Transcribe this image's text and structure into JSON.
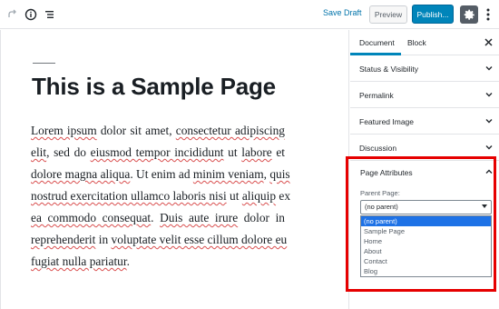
{
  "toolbar": {
    "redo_icon": "redo-icon",
    "info_icon": "info-icon",
    "outline_icon": "block-navigation-icon",
    "save_draft": "Save Draft",
    "preview": "Preview",
    "publish": "Publish...",
    "settings_icon": "gear-icon",
    "more_icon": "more-vertical-icon",
    "accent_color": "#0085ba"
  },
  "editor": {
    "title": "This is a Sample Page",
    "paragraph_lines": [
      [
        {
          "t": "Lorem ipsum",
          "sp": true
        },
        {
          "t": " dolor sit amet, ",
          "sp": false
        },
        {
          "t": "consectetur adipiscing",
          "sp": true
        }
      ],
      [
        {
          "t": "elit",
          "sp": true
        },
        {
          "t": ", sed do ",
          "sp": false
        },
        {
          "t": "eiusmod tempor incididunt",
          "sp": true
        },
        {
          "t": " ut ",
          "sp": false
        },
        {
          "t": "labore",
          "sp": true
        },
        {
          "t": " et",
          "sp": false
        }
      ],
      [
        {
          "t": "dolore magna aliqua",
          "sp": true
        },
        {
          "t": ". Ut enim ad ",
          "sp": false
        },
        {
          "t": "minim veniam",
          "sp": true
        },
        {
          "t": ", ",
          "sp": false
        },
        {
          "t": "quis",
          "sp": true
        }
      ],
      [
        {
          "t": "nostrud exercitation ullamco laboris nisi",
          "sp": true
        },
        {
          "t": " ut ",
          "sp": false
        },
        {
          "t": "aliquip",
          "sp": true
        },
        {
          "t": " ex",
          "sp": false
        }
      ],
      [
        {
          "t": "ea commodo consequat",
          "sp": true
        },
        {
          "t": ". ",
          "sp": false
        },
        {
          "t": "Duis aute irure",
          "sp": true
        },
        {
          "t": " dolor in",
          "sp": false
        }
      ],
      [
        {
          "t": "reprehenderit",
          "sp": true
        },
        {
          "t": " in ",
          "sp": false
        },
        {
          "t": "voluptate velit esse cillum dolore eu",
          "sp": true
        }
      ],
      [
        {
          "t": "fugiat nulla pariatur",
          "sp": true
        },
        {
          "t": ".",
          "sp": false
        }
      ]
    ]
  },
  "sidebar": {
    "tabs": [
      "Document",
      "Block"
    ],
    "close_icon": "close-icon",
    "panels": [
      "Status & Visibility",
      "Permalink",
      "Featured Image",
      "Discussion"
    ],
    "page_attributes": {
      "title": "Page Attributes",
      "parent_label": "Parent Page:",
      "selected": "(no parent)",
      "options": [
        "(no parent)",
        "Sample Page",
        "Home",
        "About",
        "Contact",
        "Blog"
      ]
    }
  }
}
